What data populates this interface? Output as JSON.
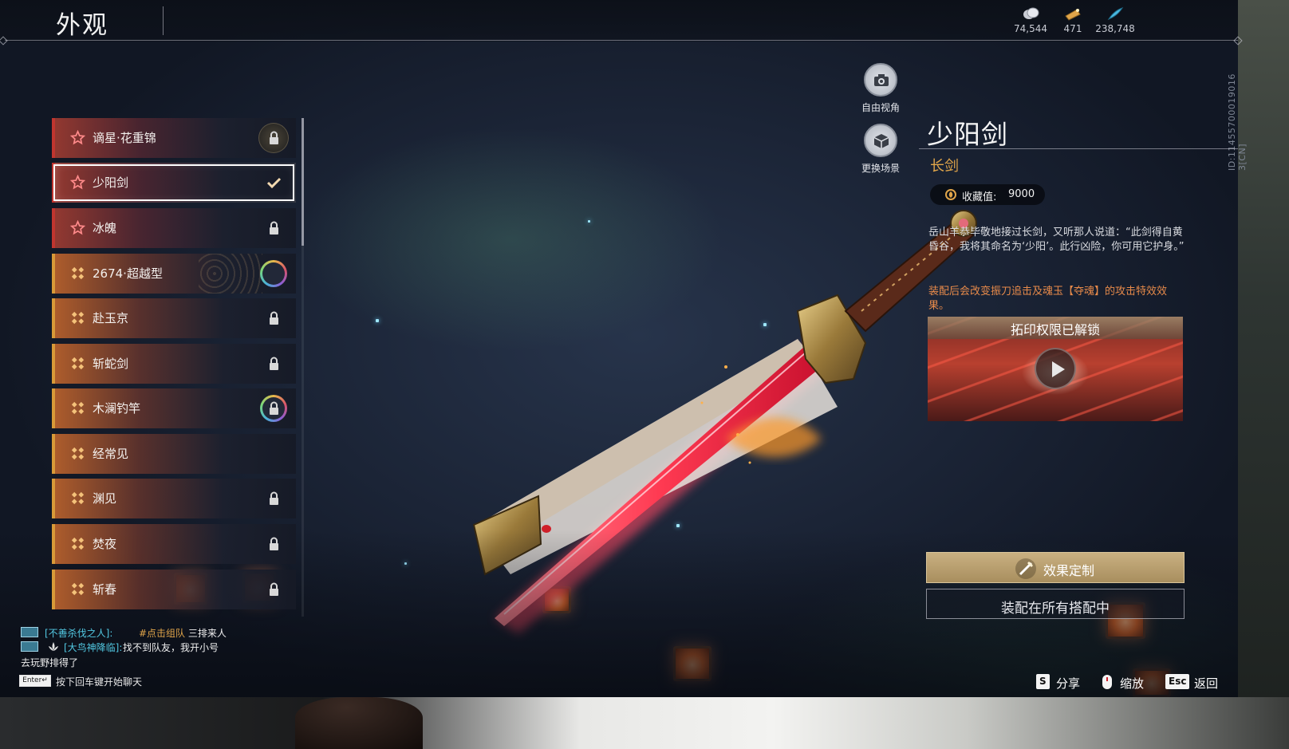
{
  "header": {
    "title": "外观"
  },
  "currencies": [
    {
      "icon": "silver-coin-icon",
      "value": "74,544"
    },
    {
      "icon": "gold-ticket-icon",
      "value": "471"
    },
    {
      "icon": "blue-feather-icon",
      "value": "238,748"
    }
  ],
  "player_id": "ID:11455700019016 3[CN]",
  "skin_list": [
    {
      "label": "谪星·花重锦",
      "rarity": "red",
      "status": "locked-badge"
    },
    {
      "label": "少阳剑",
      "rarity": "red",
      "status": "equipped"
    },
    {
      "label": "冰魄",
      "rarity": "red",
      "status": "locked"
    },
    {
      "label": "2674·超越型",
      "rarity": "gold",
      "status": "ring"
    },
    {
      "label": "赴玉京",
      "rarity": "gold",
      "status": "locked"
    },
    {
      "label": "斩蛇剑",
      "rarity": "gold",
      "status": "locked"
    },
    {
      "label": "木澜钓竿",
      "rarity": "gold",
      "status": "ring-locked"
    },
    {
      "label": "经常见",
      "rarity": "gold",
      "status": "none"
    },
    {
      "label": "渊见",
      "rarity": "gold",
      "status": "locked"
    },
    {
      "label": "焚夜",
      "rarity": "gold",
      "status": "locked"
    },
    {
      "label": "斩春",
      "rarity": "gold",
      "status": "locked"
    }
  ],
  "view_controls": {
    "free_view": "自由视角",
    "change_scene": "更换场景"
  },
  "detail": {
    "name": "少阳剑",
    "type": "长剑",
    "collect_label": "收藏值:",
    "collect_value": "9000",
    "description": "岳山羊恭毕敬地接过长剑，又听那人说道：“此剑得自黄昏谷，我将其命名为‘少阳’。此行凶险，你可用它护身。”",
    "effect": "装配后会改变振刀追击及魂玉【夺魂】的攻击特效效果。",
    "video_title": "拓印权限已解锁",
    "customize_button": "效果定制",
    "equip_all_button": "装配在所有搭配中"
  },
  "chat": {
    "messages": [
      {
        "name": "[不善杀伐之人]:",
        "link": "#点击组队",
        "text": " 三排来人"
      },
      {
        "name": "[大鸟神降临]:",
        "link": "",
        "text": "找不到队友，我开小号"
      }
    ],
    "continuation": "去玩野排得了",
    "enter_key": "Enter↵",
    "hint": "按下回车键开始聊天"
  },
  "hotkeys": [
    {
      "key": "S",
      "label": "分享"
    },
    {
      "key": "",
      "label": "缩放"
    },
    {
      "key": "Esc",
      "label": "返回"
    }
  ],
  "colors": {
    "accent_gold": "#e0a54a",
    "rarity_red": "#c0352f",
    "rarity_gold": "#d89a38",
    "effect_text": "#e78a4a",
    "chat_name": "#52c9e3"
  }
}
